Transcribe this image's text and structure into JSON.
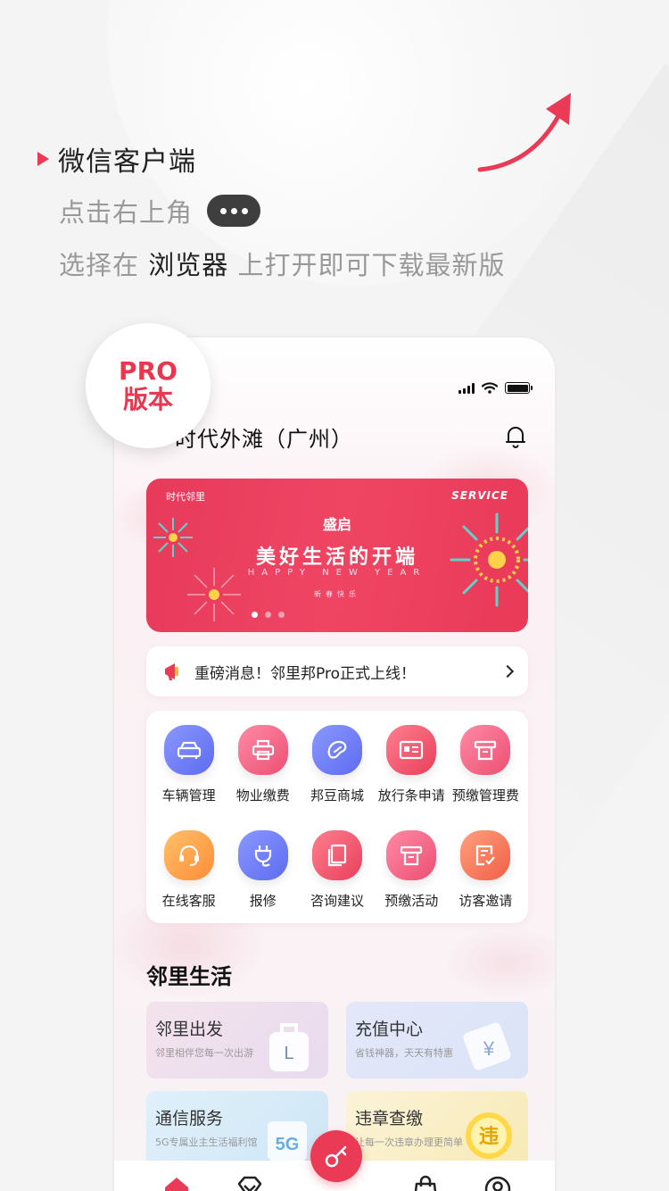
{
  "instructions": {
    "line1": "微信客户端",
    "line2": "点击右上角",
    "line3_a": "选择在 ",
    "line3_b": "浏览器",
    "line3_c": " 上打开即可下载最新版"
  },
  "badge": {
    "line1": "PRO",
    "line2": "版本"
  },
  "app": {
    "header_title": "时代外滩（广州）",
    "banner": {
      "logo": "时代邻里",
      "service": "SERVICE",
      "line1": "盛启",
      "line2": "美好生活的开端",
      "line3": "HAPPY NEW YEAR",
      "line4": "新春快乐"
    },
    "notice": "重磅消息！邻里邦Pro正式上线！",
    "grid": [
      {
        "label": "车辆管理",
        "icon": "car-icon"
      },
      {
        "label": "物业缴费",
        "icon": "printer-icon"
      },
      {
        "label": "邦豆商城",
        "icon": "bean-icon"
      },
      {
        "label": "放行条申请",
        "icon": "pass-card-icon"
      },
      {
        "label": "预缴管理费",
        "icon": "receipt-icon"
      },
      {
        "label": "在线客服",
        "icon": "headset-icon"
      },
      {
        "label": "报修",
        "icon": "plug-icon"
      },
      {
        "label": "咨询建议",
        "icon": "document-icon"
      },
      {
        "label": "预缴活动",
        "icon": "receipt-icon"
      },
      {
        "label": "访客邀请",
        "icon": "checklist-icon"
      }
    ],
    "section_title": "邻里生活",
    "life_cards": [
      {
        "title": "邻里出发",
        "sub": "邻里相伴您每一次出游"
      },
      {
        "title": "充值中心",
        "sub": "省钱神器，天天有特惠"
      },
      {
        "title": "通信服务",
        "sub": "5G专属业主生活福利馆"
      },
      {
        "title": "违章查缴",
        "sub": "让每一次违章办理更简单"
      }
    ],
    "deco": {
      "luggage": "L",
      "yen": "¥",
      "fiveg": "5G",
      "violation": "违"
    }
  },
  "colors": {
    "accent": "#ea3a55"
  }
}
